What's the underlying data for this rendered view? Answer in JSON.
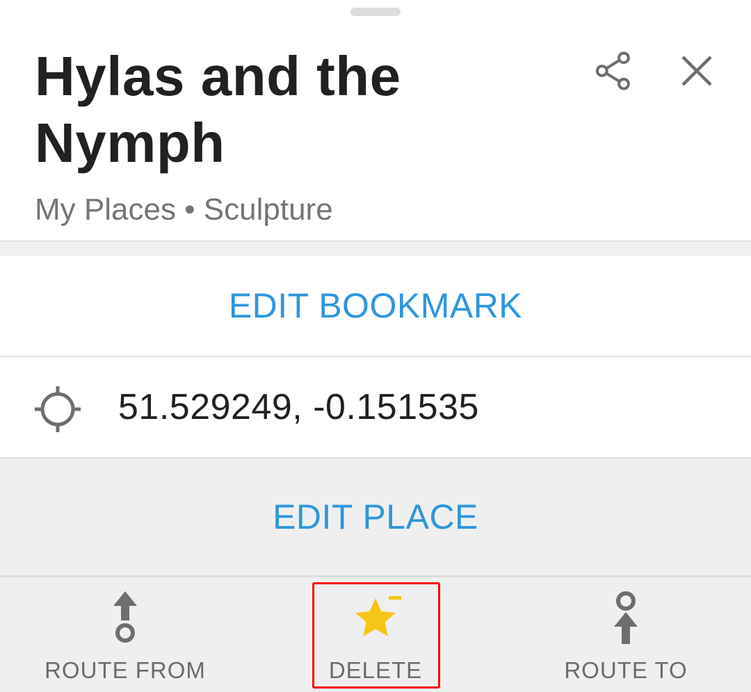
{
  "header": {
    "title": "Hylas and the Nymph",
    "subtitle": "My Places • Sculpture",
    "share_icon": "share-icon",
    "close_icon": "close-icon"
  },
  "actions": {
    "edit_bookmark_label": "EDIT BOOKMARK",
    "edit_place_label": "EDIT PLACE"
  },
  "location": {
    "coordinates": "51.529249, -0.151535",
    "icon": "location-crosshair-icon"
  },
  "bottom_bar": {
    "route_from_label": "ROUTE FROM",
    "delete_label": "DELETE",
    "route_to_label": "ROUTE TO"
  },
  "colors": {
    "accent": "#2e96dd",
    "star": "#f5c518",
    "highlight": "#ff0000"
  }
}
